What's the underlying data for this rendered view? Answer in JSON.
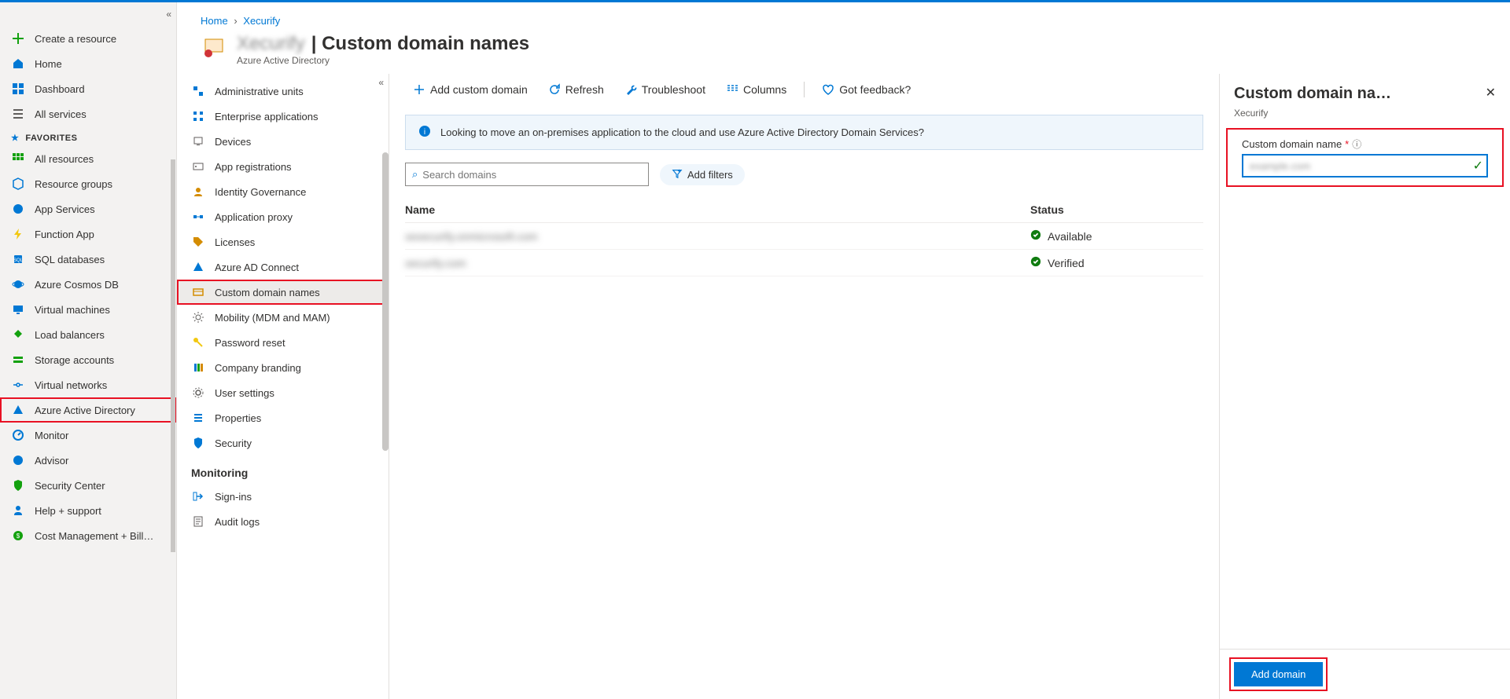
{
  "breadcrumb": {
    "home": "Home",
    "item": "Xecurify"
  },
  "page": {
    "blurred": "Xecurify",
    "title": "| Custom domain names",
    "subtitle": "Azure Active Directory"
  },
  "leftnav": {
    "create": "Create a resource",
    "home": "Home",
    "dashboard": "Dashboard",
    "allservices": "All services",
    "favorites_label": "FAVORITES",
    "items": [
      "All resources",
      "Resource groups",
      "App Services",
      "Function App",
      "SQL databases",
      "Azure Cosmos DB",
      "Virtual machines",
      "Load balancers",
      "Storage accounts",
      "Virtual networks",
      "Azure Active Directory",
      "Monitor",
      "Advisor",
      "Security Center",
      "Help + support",
      "Cost Management + Bill…"
    ]
  },
  "subnav": {
    "items": [
      "Administrative units",
      "Enterprise applications",
      "Devices",
      "App registrations",
      "Identity Governance",
      "Application proxy",
      "Licenses",
      "Azure AD Connect",
      "Custom domain names",
      "Mobility (MDM and MAM)",
      "Password reset",
      "Company branding",
      "User settings",
      "Properties",
      "Security"
    ],
    "section": "Monitoring",
    "mon": [
      "Sign-ins",
      "Audit logs"
    ]
  },
  "toolbar": {
    "add": "Add custom domain",
    "refresh": "Refresh",
    "trouble": "Troubleshoot",
    "columns": "Columns",
    "feedback": "Got feedback?"
  },
  "banner": "Looking to move an on-premises application to the cloud and use Azure Active Directory Domain Services?",
  "search": {
    "placeholder": "Search domains",
    "addfilters": "Add filters"
  },
  "table": {
    "h_name": "Name",
    "h_status": "Status",
    "rows": [
      {
        "name": "xexecurify.onmicrosoft.com",
        "status": "Available"
      },
      {
        "name": "xecurify.com",
        "status": "Verified"
      }
    ]
  },
  "blade": {
    "title": "Custom domain na…",
    "sub": "Xecurify",
    "label": "Custom domain name",
    "input_placeholder": "example.com",
    "button": "Add domain"
  }
}
